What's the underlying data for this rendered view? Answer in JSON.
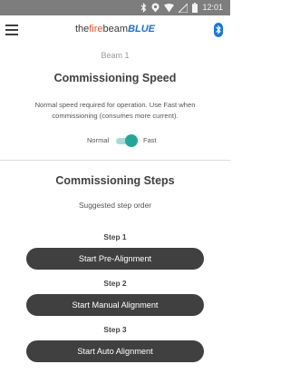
{
  "status_bar": {
    "time": "12:01",
    "icons": [
      "bluetooth-icon",
      "location-icon",
      "wifi-icon",
      "signal-icon",
      "battery-icon"
    ]
  },
  "header": {
    "brand_the": "the",
    "brand_fire": "fire",
    "brand_beam": "beam",
    "brand_blue": "BLUE",
    "menu_icon": "hamburger-menu-icon",
    "bluetooth_icon": "bluetooth-icon"
  },
  "beam": {
    "name": "Beam 1"
  },
  "speed": {
    "title": "Commissioning Speed",
    "description": "Normal speed required for operation. Use Fast when commissioning (consumes more current).",
    "normal_label": "Normal",
    "fast_label": "Fast",
    "selected": "Fast"
  },
  "steps": {
    "title": "Commissioning Steps",
    "subtitle": "Suggested step order",
    "items": [
      {
        "label": "Step 1",
        "button": "Start Pre-Alignment"
      },
      {
        "label": "Step 2",
        "button": "Start Manual Alignment"
      },
      {
        "label": "Step 3",
        "button": "Start Auto Alignment"
      }
    ]
  },
  "colors": {
    "status_bar": "#7d7d7d",
    "fire_text": "#e7532f",
    "blue_text": "#1e72c8",
    "toggle_on": "#26a69a",
    "button_bg": "#404040"
  }
}
